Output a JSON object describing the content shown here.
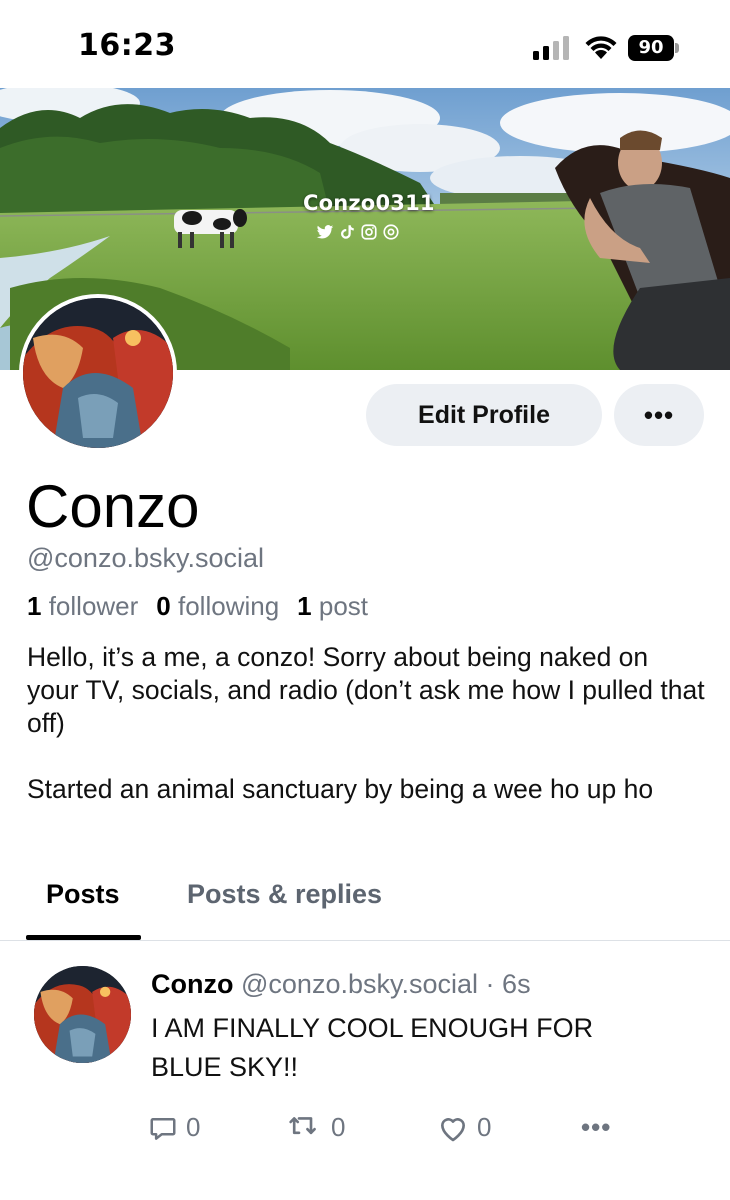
{
  "status_bar": {
    "time": "16:23",
    "battery": "90"
  },
  "banner": {
    "handle": "Conzo0311",
    "social_icons": [
      "twitter-icon",
      "tiktok-icon",
      "instagram-icon",
      "onlyfans-icon"
    ]
  },
  "profile": {
    "display_name": "Conzo",
    "handle": "@conzo.bsky.social",
    "followers_count": "1",
    "followers_label": "follower",
    "following_count": "0",
    "following_label": "following",
    "posts_count": "1",
    "posts_label": "post",
    "bio": "Hello, it’s a me, a conzo! Sorry about being naked on your TV, socials, and radio (don’t ask me how I pulled that off)\n\nStarted an animal sanctuary by being a wee ho up ho"
  },
  "actions": {
    "edit_profile_label": "Edit Profile",
    "more_label": "•••"
  },
  "tabs": [
    {
      "label": "Posts",
      "active": true
    },
    {
      "label": "Posts & replies",
      "active": false
    }
  ],
  "post": {
    "author": "Conzo",
    "handle": "@conzo.bsky.social",
    "separator": "·",
    "time": "6s",
    "text": "I AM FINALLY COOL ENOUGH FOR BLUE SKY!!",
    "reply_count": "0",
    "repost_count": "0",
    "like_count": "0",
    "more_label": "•••"
  },
  "colors": {
    "button_bg": "#eceff3",
    "muted_text": "#6e7580",
    "tab_underline": "#000000"
  }
}
